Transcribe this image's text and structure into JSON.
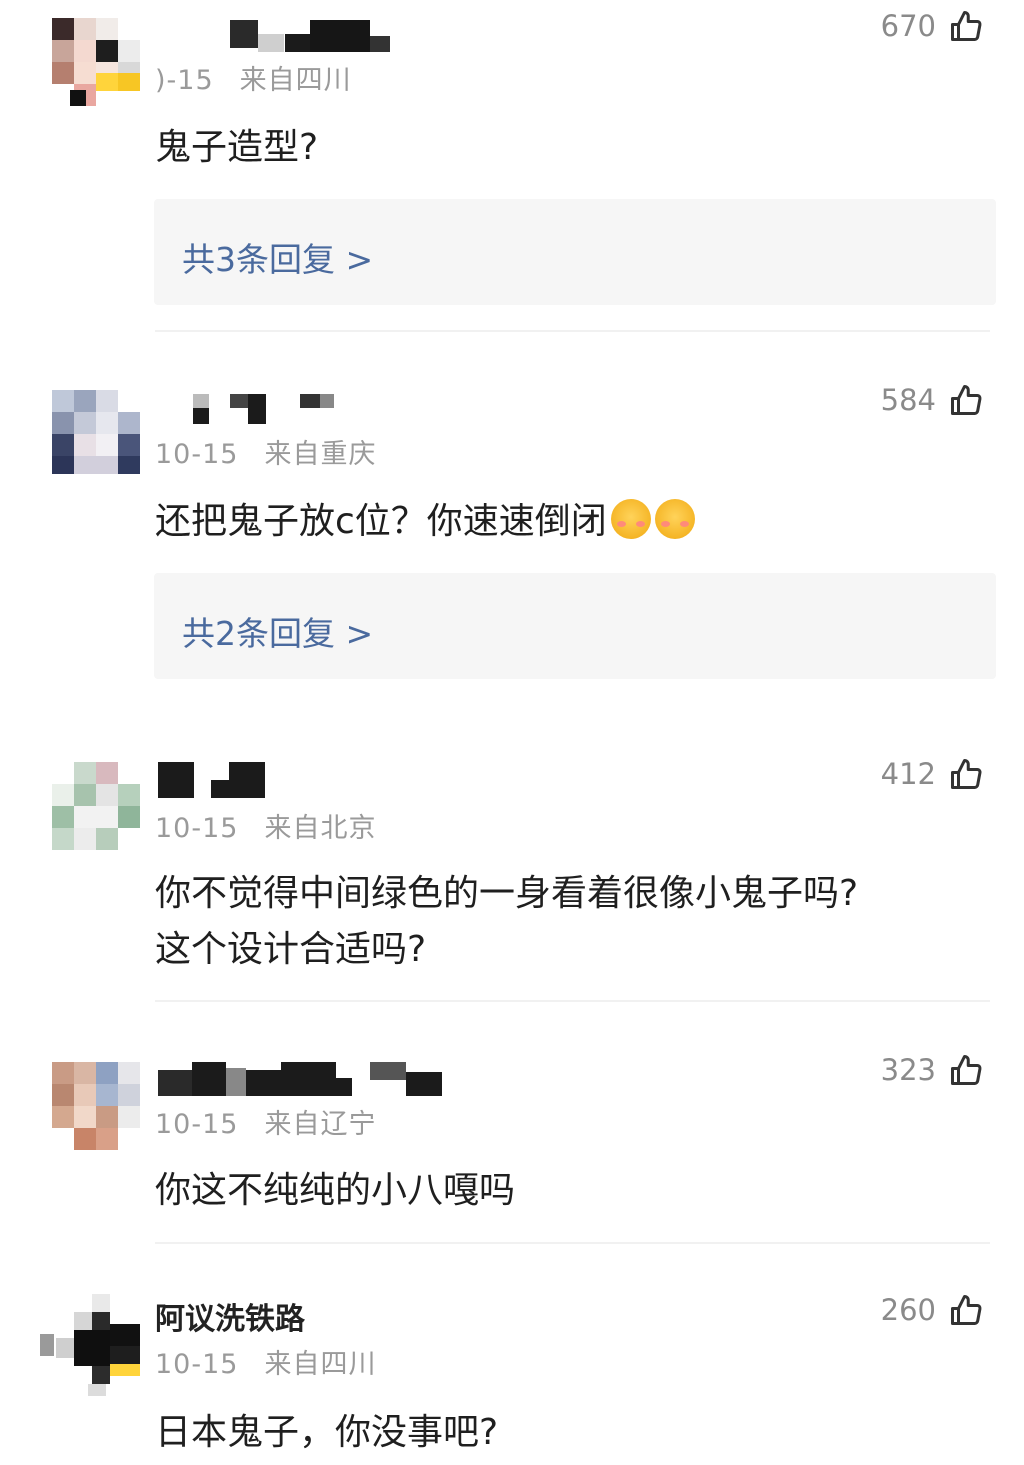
{
  "comments": [
    {
      "date": ")-15",
      "location": "来自四川",
      "likes": "670",
      "text": "鬼子造型?",
      "replies": "共3条回复 >"
    },
    {
      "date": "10-15",
      "location": "来自重庆",
      "likes": "584",
      "text": "还把鬼子放c位？你速速倒闭",
      "replies": "共2条回复 >"
    },
    {
      "date": "10-15",
      "location": "来自北京",
      "likes": "412",
      "text_line1": "你不觉得中间绿色的一身看着很像小鬼子吗?",
      "text_line2": "这个设计合适吗?"
    },
    {
      "date": "10-15",
      "location": "来自辽宁",
      "likes": "323",
      "text": "你这不纯纯的小八嘎吗"
    },
    {
      "username": "阿议洗铁路",
      "date": "10-15",
      "location": "来自四川",
      "likes": "260",
      "text": "日本鬼子，你没事吧?"
    }
  ],
  "icons": {
    "like": "thumbs-up-outline-icon",
    "emoji": "blushing-smile-emoji"
  },
  "colors": {
    "reply_link": "#4a6a9e",
    "meta": "#9a9a9a",
    "reply_bg": "#f6f6f6"
  }
}
